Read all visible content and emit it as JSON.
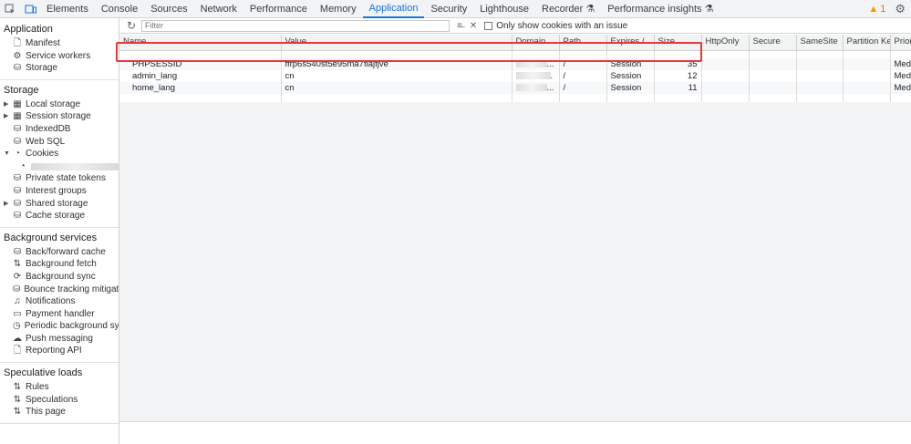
{
  "tabs": [
    "Elements",
    "Console",
    "Sources",
    "Network",
    "Performance",
    "Memory",
    "Application",
    "Security",
    "Lighthouse",
    "Recorder",
    "Performance insights"
  ],
  "active_tab": "Application",
  "warnings_count": "1",
  "sidebar": {
    "application": {
      "title": "Application",
      "items": [
        "Manifest",
        "Service workers",
        "Storage"
      ]
    },
    "storage": {
      "title": "Storage",
      "items": [
        "Local storage",
        "Session storage",
        "IndexedDB",
        "Web SQL",
        "Cookies",
        "Private state tokens",
        "Interest groups",
        "Shared storage",
        "Cache storage"
      ]
    },
    "background": {
      "title": "Background services",
      "items": [
        "Back/forward cache",
        "Background fetch",
        "Background sync",
        "Bounce tracking mitigations",
        "Notifications",
        "Payment handler",
        "Periodic background sync",
        "Push messaging",
        "Reporting API"
      ]
    },
    "speculative": {
      "title": "Speculative loads",
      "items": [
        "Rules",
        "Speculations",
        "This page"
      ]
    }
  },
  "toolbar": {
    "filter_placeholder": "Filter",
    "only_issue_label": "Only show cookies with an issue"
  },
  "table": {
    "columns": [
      "Name",
      "Value",
      "Domain",
      "Path",
      "Expires / ...",
      "Size",
      "HttpOnly",
      "Secure",
      "SameSite",
      "Partition Key",
      "Prior"
    ],
    "rows": [
      {
        "name": "PHPSESSID",
        "value": "ffrp6s540st5e95ma7fiajfjve",
        "domain": "...",
        "path": "/",
        "expires": "Session",
        "size": "35",
        "priority": "Medi"
      },
      {
        "name": "admin_lang",
        "value": "cn",
        "domain": ".",
        "path": "/",
        "expires": "Session",
        "size": "12",
        "priority": "Medi"
      },
      {
        "name": "home_lang",
        "value": "cn",
        "domain": "...",
        "path": "/",
        "expires": "Session",
        "size": "11",
        "priority": "Medi"
      }
    ]
  },
  "colors": {
    "accent": "#1a73e8",
    "highlight": "#e53935",
    "warning": "#f29900"
  }
}
